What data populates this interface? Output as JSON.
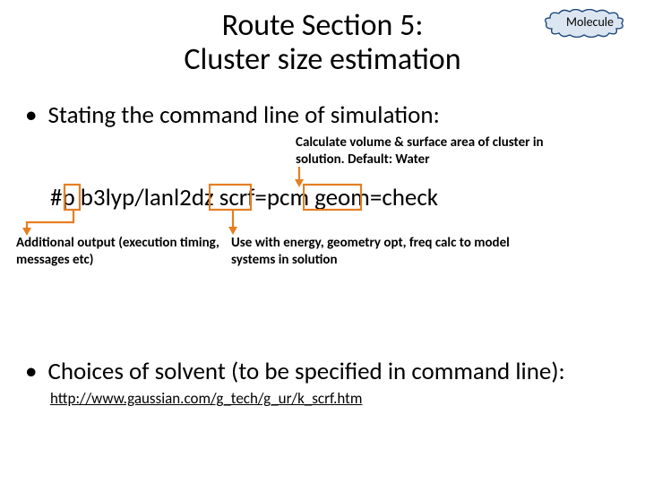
{
  "title_line1": "Route Section 5:",
  "title_line2": "Cluster size estimation",
  "cloud_label": "Molecule",
  "bullet1": "Stating the command line of simulation:",
  "note_top": "Calculate volume & surface area of cluster in solution. Default: Water",
  "cmd": "#p b3lyp/lanl2dz scrf=pcm geom=check",
  "note_left": "Additional output (execution timing, messages etc)",
  "note_right": "Use with energy, geometry opt, freq calc to model systems in solution",
  "bullet2": "Choices of solvent (to be specified in command line):",
  "link_text": "http://www.gaussian.com/g_tech/g_ur/k_scrf.htm",
  "link_href": "http://www.gaussian.com/g_tech/g_ur/k_scrf.htm",
  "colors": {
    "accent": "#E67E22",
    "cloud_stroke": "#1F497D",
    "cloud_fill": "#DCE6F2"
  }
}
